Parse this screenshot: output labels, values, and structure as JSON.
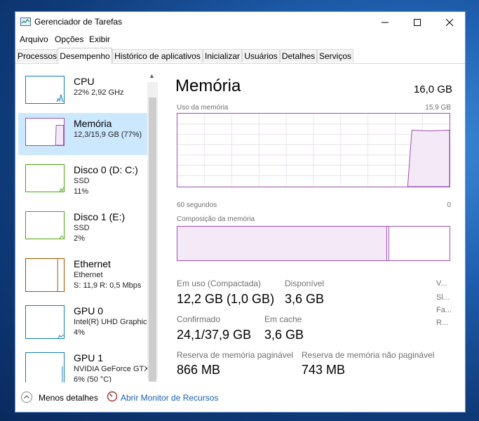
{
  "window": {
    "title": "Gerenciador de Tarefas"
  },
  "menu": [
    "Arquivo",
    "Opções",
    "Exibir"
  ],
  "tabs": [
    "Processos",
    "Desempenho",
    "Histórico de aplicativos",
    "Inicializar",
    "Usuários",
    "Detalhes",
    "Serviços"
  ],
  "sidebar": {
    "items": [
      {
        "name": "CPU",
        "line1": "22%  2,92 GHz",
        "line2": "",
        "color": "#117dbb"
      },
      {
        "name": "Memória",
        "line1": "12,3/15,9 GB (77%)",
        "line2": "",
        "color": "#8b12ae"
      },
      {
        "name": "Disco 0 (D: C:)",
        "line1": "SSD",
        "line2": "11%",
        "color": "#4da60c"
      },
      {
        "name": "Disco 1 (E:)",
        "line1": "SSD",
        "line2": "2%",
        "color": "#4da60c"
      },
      {
        "name": "Ethernet",
        "line1": "Ethernet",
        "line2": "S: 11,9  R: 0,5 Mbps",
        "color": "#a74f01"
      },
      {
        "name": "GPU 0",
        "line1": "Intel(R) UHD Graphics",
        "line2": "4%",
        "color": "#117dbb"
      },
      {
        "name": "GPU 1",
        "line1": "NVIDIA GeForce GTX",
        "line2": "6% (50 °C)",
        "color": "#117dbb"
      }
    ]
  },
  "memory": {
    "title": "Memória",
    "total": "16,0 GB",
    "usage_label": "Uso da memória",
    "usage_max": "15,9 GB",
    "time_left": "60 segundos",
    "time_right": "0",
    "composition_label": "Composição da memória",
    "stats": {
      "in_use_label": "Em uso (Compactada)",
      "in_use_value": "12,2 GB (1,0 GB)",
      "available_label": "Disponível",
      "available_value": "3,6 GB",
      "committed_label": "Confirmado",
      "committed_value": "24,1/37,9 GB",
      "cached_label": "Em cache",
      "cached_value": "3,6 GB",
      "paged_label": "Reserva de memória paginável",
      "paged_value": "866 MB",
      "nonpaged_label": "Reserva de memória não paginável",
      "nonpaged_value": "743 MB"
    },
    "extra_labels": [
      "V...",
      "Sl...",
      "Fa...",
      "R..."
    ]
  },
  "footer": {
    "less_details": "Menos detalhes",
    "resource_monitor": "Abrir Monitor de Recursos"
  },
  "colors": {
    "memory_accent": "#9c4fb3",
    "selected_bg": "#cce8ff",
    "link": "#1a5fb4"
  }
}
